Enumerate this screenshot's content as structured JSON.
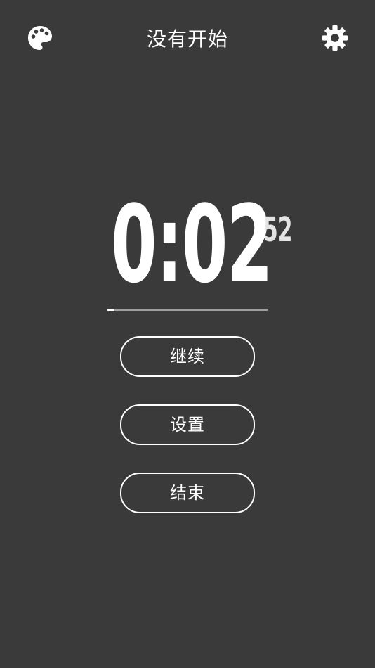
{
  "header": {
    "title": "没有开始",
    "left_icon": "palette-icon",
    "right_icon": "gear-icon"
  },
  "timer": {
    "main": "0:02",
    "hundredths": "52",
    "progress": 0.045
  },
  "buttons": {
    "continue_label": "继续",
    "settings_label": "设置",
    "end_label": "结束"
  },
  "colors": {
    "background": "#3a3a3a",
    "foreground": "#ffffff",
    "track": "#9e9e9e"
  }
}
